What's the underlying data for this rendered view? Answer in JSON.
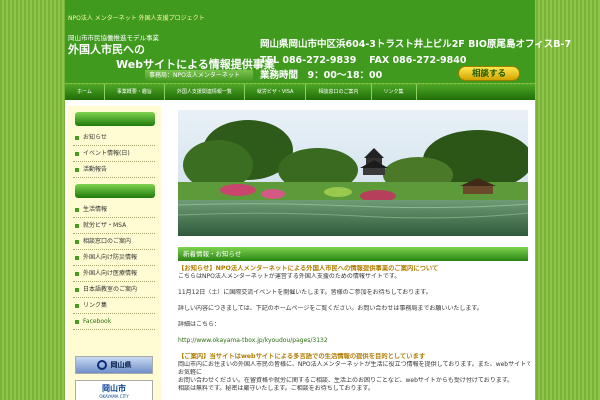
{
  "header": {
    "npo_line": "NPO法人 メンターネット 外国人支援プロジェクト",
    "blurb": "岡山市市民協働推進モデル事業",
    "title_line1": "外国人市民への",
    "title_line2": "Webサイトによる情報提供事業",
    "office": "事務局：NPO法人メンターネット",
    "address": "岡山県岡山市中区浜604-3トラスト井上ビル2F BIO原尾島オフィスB-7",
    "tel": "TEL 086-272-9839　 FAX 086-272-9840",
    "hours": "業務時間　9：00～18：00",
    "consult_label": "相談する"
  },
  "nav": [
    "ホーム",
    "事業概要・趣旨",
    "外国人支援関連情報一覧",
    "就労ビザ・VISA",
    "相談窓口のご案内",
    "リンク集"
  ],
  "sidebar": {
    "group1": [
      "お知らせ",
      "イベント情報(日)",
      "活動報告"
    ],
    "group2": [
      "生活情報",
      "就労ビザ・MSA",
      "相談窓口のご案内",
      "外国人向け防災情報",
      "外国人向け医療情報",
      "日本語教室のご案内",
      "リンク集",
      "Facebook"
    ],
    "banner_pref": "岡山県",
    "banner_city": "岡山市",
    "banner_city_en": "OKAYAMA CITY"
  },
  "main": {
    "section_title": "新着情報・お知らせ",
    "lines": [
      {
        "cls": "h",
        "text": "【お知らせ】NPO法人メンターネットによる外国人市民への情報提供事業のご案内について"
      },
      {
        "cls": "",
        "text": "こちらはNPO法人メンターネットが運営する外国人支援のための情報サイトです。"
      },
      {
        "cls": "",
        "text": ""
      },
      {
        "cls": "",
        "text": "11月12日（土）に国際交流イベントを開催いたします。皆様のご参加をお待ちしております。"
      },
      {
        "cls": "",
        "text": ""
      },
      {
        "cls": "",
        "text": "詳しい内容につきましては、下記のホームページをご覧ください。お問い合わせは事務局までお願いいたします。"
      },
      {
        "cls": "",
        "text": ""
      },
      {
        "cls": "",
        "text": "詳細はこちら："
      },
      {
        "cls": "",
        "text": ""
      },
      {
        "cls": "link",
        "text": "http://www.okayama-tbox.jp/kyoudou/pages/3132"
      },
      {
        "cls": "",
        "text": ""
      },
      {
        "cls": "h",
        "text": "【ご案内】当サイトはwebサイトによる多言語での生活情報の提供を目的としています"
      },
      {
        "cls": "",
        "text": "岡山市内にお住まいの外国人市民の皆様に、NPO法人メンターネットが生活に役立つ情報を提供しております。また、webサイトでの情報提供に加えて、各種相談も受け付けております"
      },
      {
        "cls": "",
        "text": "お気軽に"
      },
      {
        "cls": "",
        "text": "お問い合わせください。在留資格や就労に関するご相談、生活上のお困りごとなど、webサイトからも受け付けております。"
      },
      {
        "cls": "",
        "text": "相談は無料です。秘密は厳守いたします。ご相談をお待ちしております。"
      }
    ]
  }
}
